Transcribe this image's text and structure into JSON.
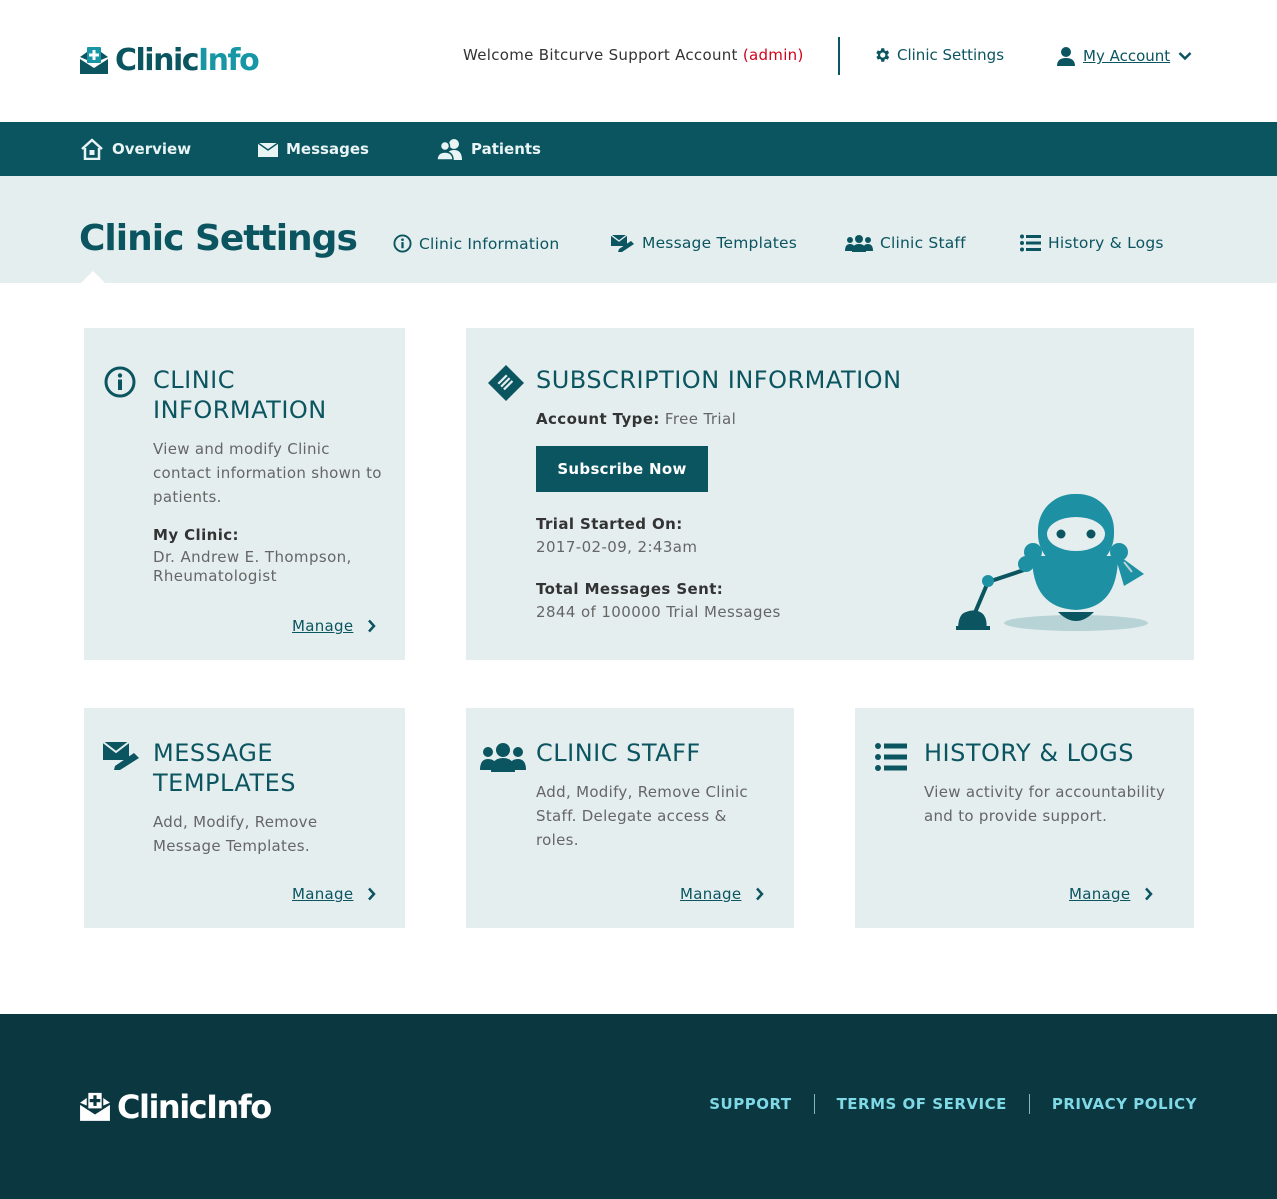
{
  "brand": {
    "name_part1": "Clinic",
    "name_part2": "Info",
    "footer_name": "ClinicInfo"
  },
  "colors": {
    "primary": "#0b5560",
    "accent": "#1797a6",
    "panel": "#e5eeef",
    "footer": "#0a3740",
    "admin": "#d0021b",
    "footer_link": "#7fd9e6"
  },
  "header": {
    "welcome_text": "Welcome Bitcurve Support Account ",
    "role": "(admin)",
    "settings_label": "Clinic Settings",
    "account_label": "My Account"
  },
  "nav": {
    "items": [
      {
        "label": "Overview",
        "icon": "home-icon"
      },
      {
        "label": "Messages",
        "icon": "envelope-icon"
      },
      {
        "label": "Patients",
        "icon": "users-icon"
      }
    ]
  },
  "subheader": {
    "title": "Clinic Settings",
    "tabs": [
      {
        "label": "Clinic Information",
        "icon": "info-icon"
      },
      {
        "label": "Message Templates",
        "icon": "template-icon"
      },
      {
        "label": "Clinic Staff",
        "icon": "staff-icon"
      },
      {
        "label": "History & Logs",
        "icon": "list-icon"
      }
    ]
  },
  "cards": {
    "clinic_info": {
      "title": "CLINIC INFORMATION",
      "desc": "View and modify Clinic contact information shown to patients.",
      "my_clinic_label": "My Clinic:",
      "my_clinic_value": "Dr. Andrew E. Thompson, Rheumatologist",
      "manage": "Manage"
    },
    "subscription": {
      "title": "SUBSCRIPTION INFORMATION",
      "account_type_label": "Account Type:",
      "account_type_value": "Free Trial",
      "subscribe_label": "Subscribe Now",
      "trial_started_label": "Trial Started On:",
      "trial_started_value": "2017-02-09, 2:43am",
      "messages_sent_label": "Total Messages Sent:",
      "messages_sent_value": "2844 of 100000 Trial Messages"
    },
    "templates": {
      "title": "MESSAGE TEMPLATES",
      "desc": "Add, Modify, Remove Message Templates.",
      "manage": "Manage"
    },
    "staff": {
      "title": "CLINIC STAFF",
      "desc": "Add, Modify, Remove Clinic Staff. Delegate access & roles.",
      "manage": "Manage"
    },
    "history": {
      "title": "HISTORY & LOGS",
      "desc": "View activity for accountability and to provide support.",
      "manage": "Manage"
    }
  },
  "footer": {
    "links": [
      "SUPPORT",
      "TERMS OF SERVICE",
      "PRIVACY POLICY"
    ]
  }
}
